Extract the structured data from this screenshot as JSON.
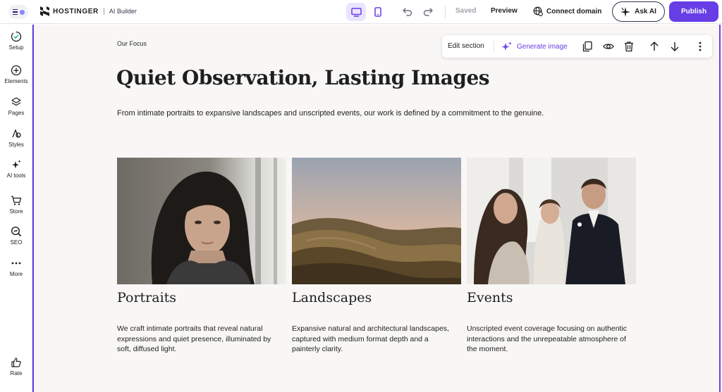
{
  "topbar": {
    "brand_name": "HOSTINGER",
    "brand_product": "AI Builder",
    "saved_label": "Saved",
    "preview_label": "Preview",
    "connect_domain_label": "Connect domain",
    "ask_ai_label": "Ask AI",
    "publish_label": "Publish"
  },
  "sidebar": {
    "items": [
      {
        "label": "Setup",
        "icon": "setup-icon"
      },
      {
        "label": "Elements",
        "icon": "plus-circle-icon"
      },
      {
        "label": "Pages",
        "icon": "layers-icon"
      },
      {
        "label": "Styles",
        "icon": "styles-icon"
      },
      {
        "label": "AI tools",
        "icon": "sparkles-icon"
      },
      {
        "label": "Store",
        "icon": "cart-icon"
      },
      {
        "label": "SEO",
        "icon": "seo-icon"
      },
      {
        "label": "More",
        "icon": "more-icon"
      }
    ],
    "rate_label": "Rate"
  },
  "section_toolbar": {
    "edit_label": "Edit section",
    "generate_label": "Generate image"
  },
  "content": {
    "eyebrow": "Our Focus",
    "headline": "Quiet Observation, Lasting Images",
    "lede": "From intimate portraits to expansive landscapes and unscripted events, our work is defined by a commitment to the genuine.",
    "cards": [
      {
        "title": "Portraits",
        "text": "We craft intimate portraits that reveal natural expressions and quiet presence, illuminated by soft, diffused light."
      },
      {
        "title": "Landscapes",
        "text": "Expansive natural and architectural landscapes, captured with medium format depth and a painterly clarity."
      },
      {
        "title": "Events",
        "text": "Unscripted event coverage focusing on authentic interactions and the unrepeatable atmosphere of the moment."
      }
    ]
  },
  "colors": {
    "accent": "#673de6",
    "canvas_bg": "#f8f7f6"
  }
}
